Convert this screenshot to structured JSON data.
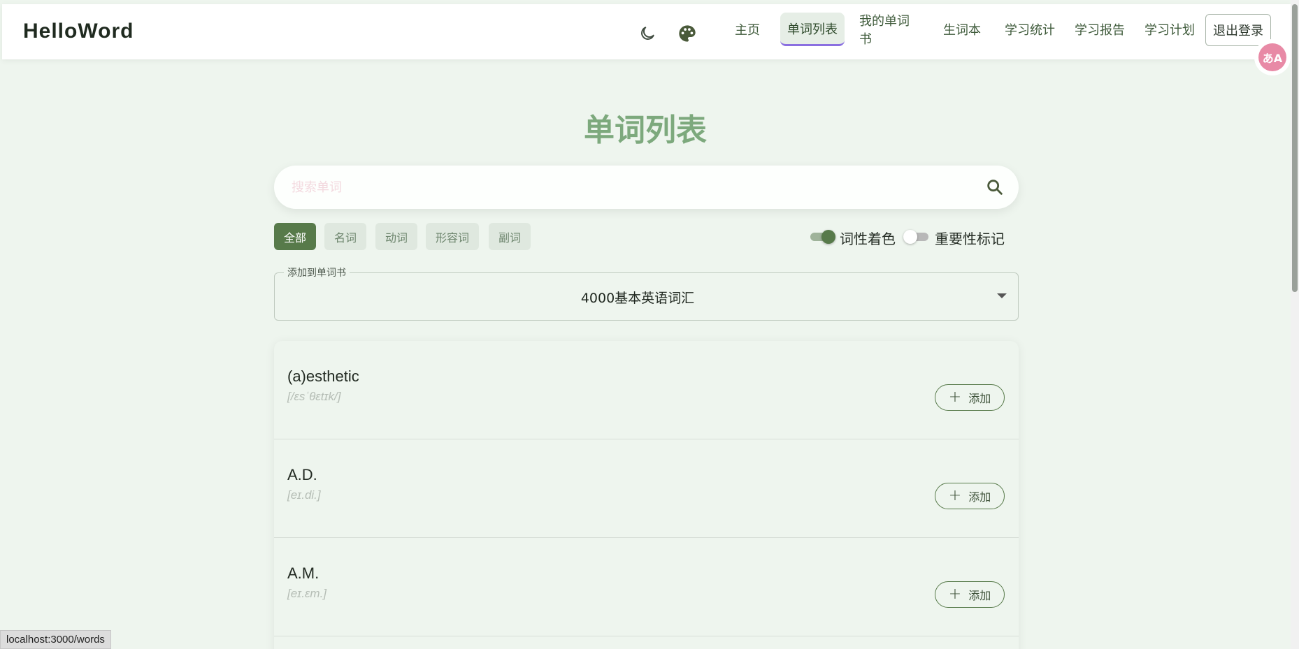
{
  "header": {
    "brand": "HelloWord",
    "icons": {
      "theme": "moon-icon",
      "palette": "palette-icon"
    },
    "nav": [
      {
        "label": "主页",
        "active": false
      },
      {
        "label": "单词列表",
        "active": true
      },
      {
        "label": "我的单词书",
        "active": false
      },
      {
        "label": "生词本",
        "active": false
      },
      {
        "label": "学习统计",
        "active": false
      },
      {
        "label": "学习报告",
        "active": false
      },
      {
        "label": "学习计划",
        "active": false
      }
    ],
    "logout_label": "退出登录"
  },
  "translate_badge": "あA",
  "main": {
    "title": "单词列表",
    "search": {
      "placeholder": "搜索单词",
      "value": ""
    },
    "filters": [
      {
        "label": "全部",
        "active": true
      },
      {
        "label": "名词",
        "active": false
      },
      {
        "label": "动词",
        "active": false
      },
      {
        "label": "形容词",
        "active": false
      },
      {
        "label": "副词",
        "active": false
      }
    ],
    "toggles": [
      {
        "label": "词性着色",
        "on": true
      },
      {
        "label": "重要性标记",
        "on": false
      }
    ],
    "wordbook_select": {
      "legend": "添加到单词书",
      "value": "4000基本英语词汇"
    },
    "words": [
      {
        "word": "(a)esthetic",
        "phonetic": "[/ɛsˈθɛtɪk/]",
        "add_label": "添加"
      },
      {
        "word": "A.D.",
        "phonetic": "[eɪ.di.]",
        "add_label": "添加"
      },
      {
        "word": "A.M.",
        "phonetic": "[eɪ.ɛm.]",
        "add_label": "添加"
      }
    ]
  },
  "colors": {
    "accent": "#577a4a",
    "title": "#7da97d",
    "background": "#eef5ee",
    "active_underline": "#8a6fe0"
  },
  "status_bar": {
    "url": "localhost:3000/words"
  }
}
